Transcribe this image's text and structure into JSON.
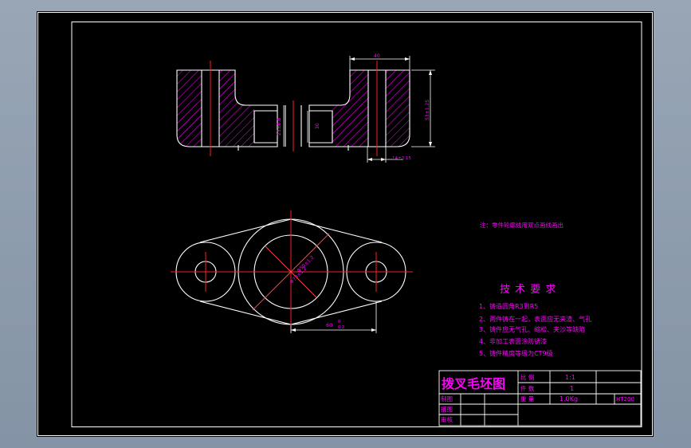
{
  "dimensions": {
    "width_40": "40",
    "height_right": "53±1.25",
    "dia_top_mid": "25±0.8",
    "small_30": "30",
    "bottom_depth": "14±2.15",
    "dia_inner": "Φ50±1.2",
    "dia_outer": "Φ73±1.2",
    "length_60": "60",
    "length_60_tol_upper": "0",
    "length_60_tol_lower": "0.2"
  },
  "note": "注：零件轮廓线用双点画线画出",
  "tech_requirements": {
    "heading": "技 术 要 求",
    "items": [
      "1、铸造圆角R3到R5",
      "2、两件铸在一起，表面应无夹渣、气孔",
      "3、铸件应无气孔、缩松、夹沙等缺陷",
      "4、非加工表面涂防锈漆",
      "5、铸件精度等级为CT9级"
    ]
  },
  "title_block": {
    "title": "拨叉毛坯图",
    "scale_label": "比 例",
    "scale_value": "1:1",
    "count_label": "件 数",
    "count_value": "1",
    "weight_label": "重 量",
    "weight_value": "1.0Kg",
    "material_value": "HT200",
    "drawn_label": "制图",
    "checked_label": "描图",
    "review_label": "审核"
  },
  "colors": {
    "outline": "#ffffff",
    "centerline": "#ff2020",
    "hatch": "#ff00ff",
    "text": "#ff00ff",
    "dimension": "#ff00ff"
  }
}
